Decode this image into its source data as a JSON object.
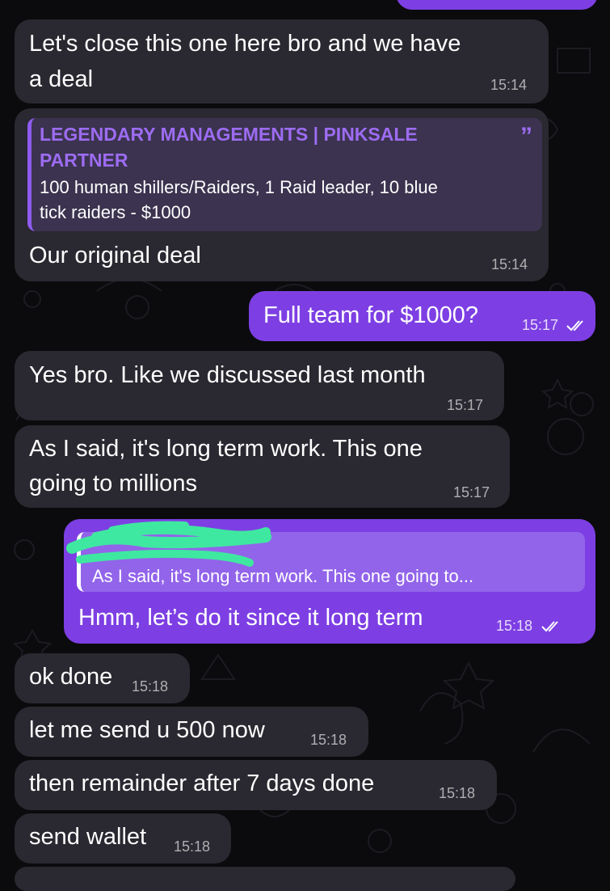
{
  "messages": [
    {
      "text_line1": "Let's close this one here bro and we have",
      "text_line2": "a deal",
      "time": "15:14"
    },
    {
      "quote_title_line1": "LEGENDARY MANAGEMENTS | PINKSALE",
      "quote_title_line2": "PARTNER",
      "quote_body_line1": "100 human shillers/Raiders, 1 Raid leader, 10 blue",
      "quote_body_line2": "tick raiders - $1000",
      "quote_mark": "”",
      "text": "Our original deal",
      "time": "15:14"
    },
    {
      "text": "Full team for $1000?",
      "time": "15:17"
    },
    {
      "text": "Yes bro. Like we discussed last month",
      "time": "15:17"
    },
    {
      "text_line1": "As I said, it's long term work. This one",
      "text_line2": "going to millions",
      "time": "15:17"
    },
    {
      "reply_text": "As I said, it's long term work. This one going to...",
      "text": "Hmm, let’s do it since it long term",
      "time": "15:18"
    },
    {
      "text": "ok done",
      "time": "15:18"
    },
    {
      "text": "let me send u 500 now",
      "time": "15:18"
    },
    {
      "text": "then remainder after 7 days done",
      "time": "15:18"
    },
    {
      "text": "send wallet",
      "time": "15:18"
    }
  ],
  "colors": {
    "incoming_bubble": "#2a2830",
    "outgoing_bubble": "#7d3fe3",
    "accent": "#9d6cf2",
    "redaction": "#3fe8a0"
  }
}
